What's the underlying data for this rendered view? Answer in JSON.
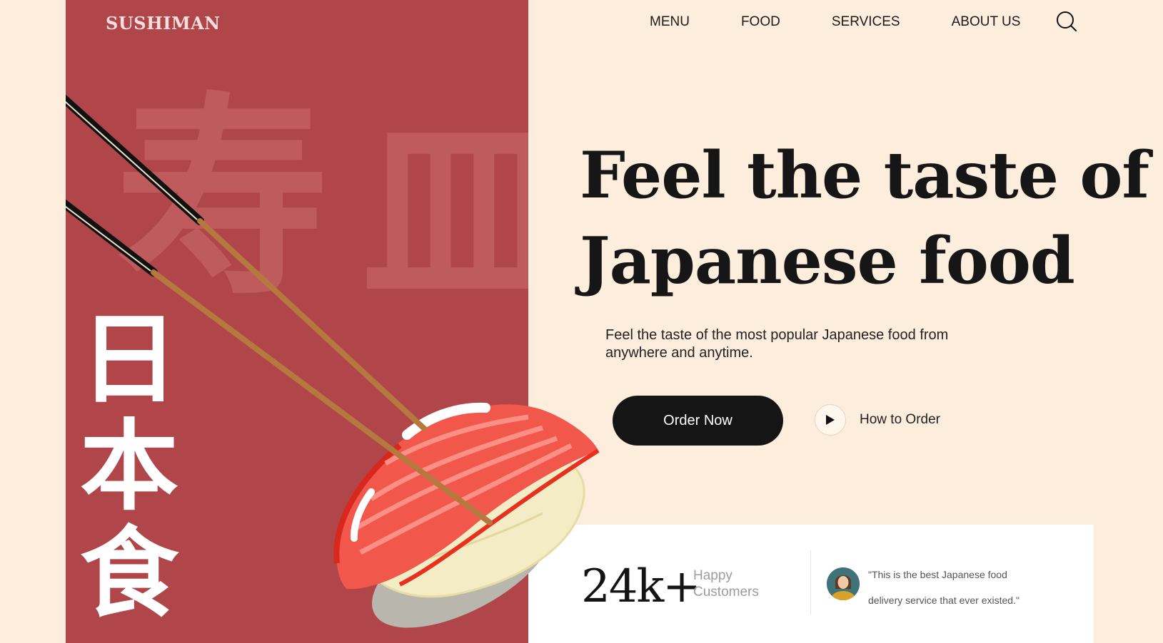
{
  "brand": {
    "name": "SUSHIMAN"
  },
  "nav": {
    "items": [
      {
        "label": "MENU"
      },
      {
        "label": "FOOD"
      },
      {
        "label": "SERVICES"
      },
      {
        "label": "ABOUT US"
      }
    ],
    "search_icon": "search-icon"
  },
  "hero": {
    "watermark": [
      "寿",
      "皿"
    ],
    "vertical_kanji": [
      "日",
      "本",
      "食"
    ],
    "headline_line1": "Feel the taste of",
    "headline_line2": "Japanese food",
    "subtitle_line1": "Feel the taste of the most popular Japanese food from",
    "subtitle_line2": "anywhere and anytime.",
    "order_button": "Order Now",
    "how_to_label": "How to Order",
    "play_icon": "play-icon"
  },
  "stats": {
    "number": "24k+",
    "label_line1": "Happy",
    "label_line2": "Customers"
  },
  "testimonial": {
    "quote_line1": "\"This is the best Japanese food",
    "quote_line2": "delivery service that ever existed.\""
  },
  "colors": {
    "background": "#fdeddc",
    "panel_red": "#b0454a",
    "dark": "#151515",
    "card": "#ffffff"
  }
}
